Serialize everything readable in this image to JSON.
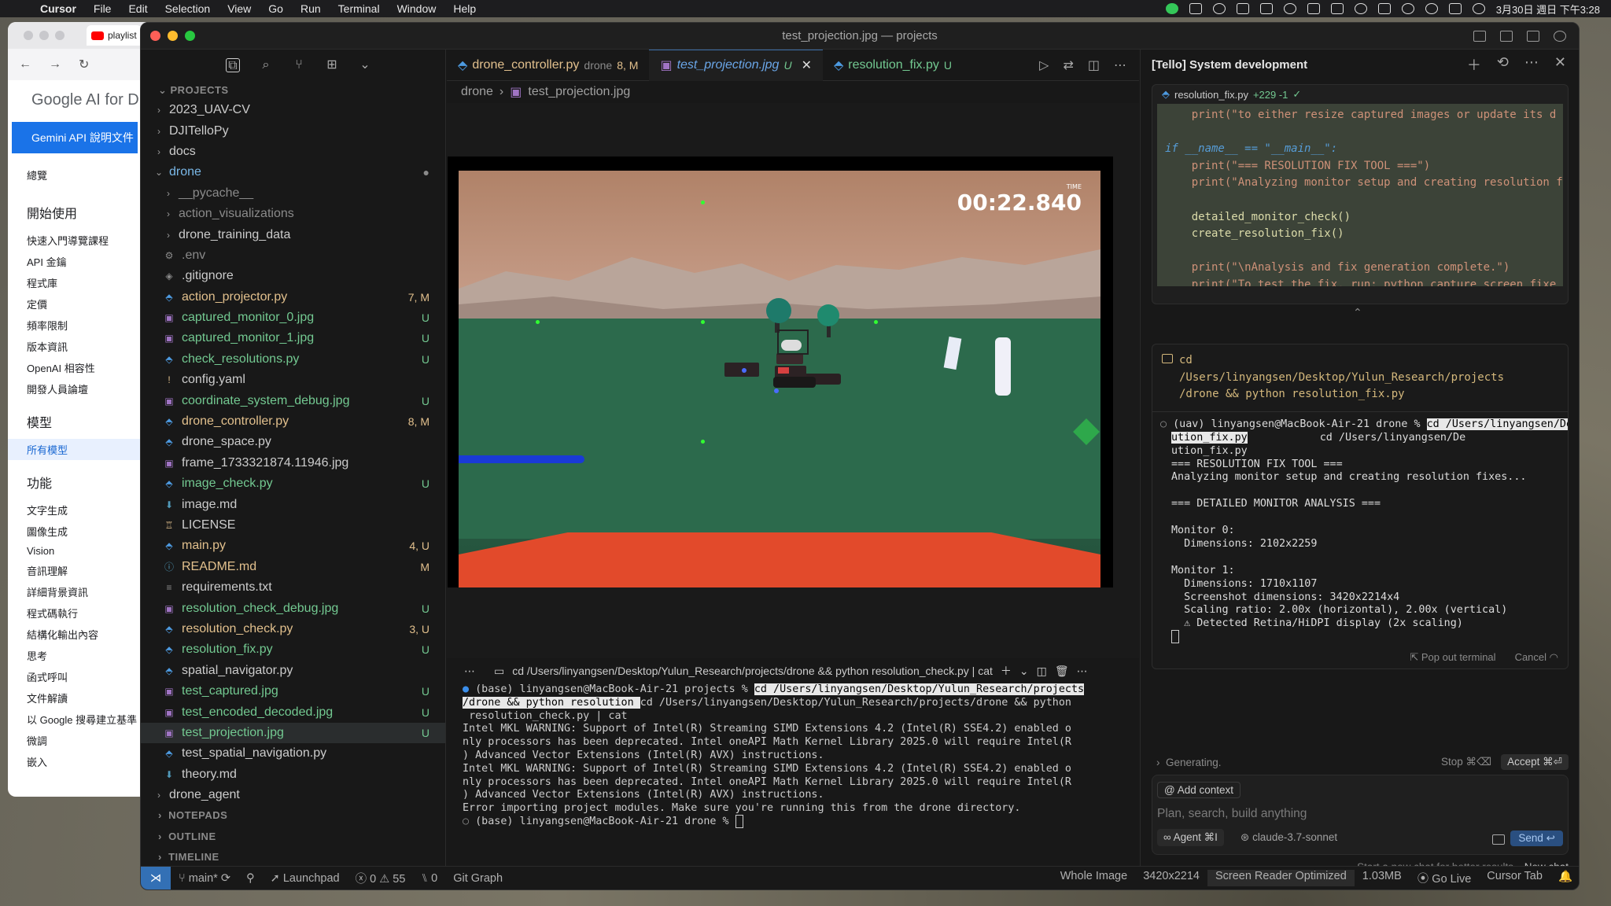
{
  "menubar": {
    "app": "Cursor",
    "items": [
      "File",
      "Edit",
      "Selection",
      "View",
      "Go",
      "Run",
      "Terminal",
      "Window",
      "Help"
    ],
    "datetime": "3月30日 週日 下午3:28"
  },
  "browser": {
    "tab_title": "playlist",
    "logo": "Google AI for D",
    "active_section": "Gemini API 說明文件",
    "sidebar": {
      "overview": "總覽",
      "get_started_h": "開始使用",
      "get_started": [
        "快速入門導覽課程",
        "API 金鑰",
        "程式庫",
        "定價",
        "頻率限制",
        "版本資訊",
        "OpenAI 相容性",
        "開發人員論壇"
      ],
      "models_h": "模型",
      "models": [
        "所有模型"
      ],
      "features_h": "功能",
      "features": [
        "文字生成",
        "圖像生成",
        "Vision",
        "音訊理解",
        "詳細背景資訊",
        "程式碼執行",
        "結構化輸出內容",
        "思考",
        "函式呼叫",
        "文件解讀",
        "以 Google 搜尋建立基準",
        "微調",
        "嵌入"
      ]
    }
  },
  "window": {
    "title": "test_projection.jpg — projects"
  },
  "explorer": {
    "projects_header": "PROJECTS",
    "rows": [
      {
        "name": "2023_UAV-CV",
        "kind": "folder",
        "depth": 0,
        "status": "",
        "color": "normal"
      },
      {
        "name": "DJITelloPy",
        "kind": "folder",
        "depth": 0,
        "status": "",
        "color": "normal"
      },
      {
        "name": "docs",
        "kind": "folder",
        "depth": 0,
        "status": "",
        "color": "normal"
      },
      {
        "name": "drone",
        "kind": "folder-open",
        "depth": 0,
        "status": "●",
        "color": "mod"
      },
      {
        "name": "__pycache__",
        "kind": "folder",
        "depth": 1,
        "status": "",
        "color": "dim"
      },
      {
        "name": "action_visualizations",
        "kind": "folder",
        "depth": 1,
        "status": "",
        "color": "dim"
      },
      {
        "name": "drone_training_data",
        "kind": "folder",
        "depth": 1,
        "status": "",
        "color": "normal"
      },
      {
        "name": ".env",
        "kind": "gear",
        "depth": 1,
        "status": "",
        "color": "dim"
      },
      {
        "name": ".gitignore",
        "kind": "git",
        "depth": 1,
        "status": "",
        "color": "normal"
      },
      {
        "name": "action_projector.py",
        "kind": "py",
        "depth": 1,
        "status": "7, M",
        "color": "mod"
      },
      {
        "name": "captured_monitor_0.jpg",
        "kind": "img",
        "depth": 1,
        "status": "U",
        "color": "untr"
      },
      {
        "name": "captured_monitor_1.jpg",
        "kind": "img",
        "depth": 1,
        "status": "U",
        "color": "untr"
      },
      {
        "name": "check_resolutions.py",
        "kind": "py",
        "depth": 1,
        "status": "U",
        "color": "untr"
      },
      {
        "name": "config.yaml",
        "kind": "yaml",
        "depth": 1,
        "status": "",
        "color": "normal"
      },
      {
        "name": "coordinate_system_debug.jpg",
        "kind": "img",
        "depth": 1,
        "status": "U",
        "color": "untr"
      },
      {
        "name": "drone_controller.py",
        "kind": "py",
        "depth": 1,
        "status": "8, M",
        "color": "mod"
      },
      {
        "name": "drone_space.py",
        "kind": "py",
        "depth": 1,
        "status": "",
        "color": "normal"
      },
      {
        "name": "frame_1733321874.11946.jpg",
        "kind": "img",
        "depth": 1,
        "status": "",
        "color": "normal"
      },
      {
        "name": "image_check.py",
        "kind": "py",
        "depth": 1,
        "status": "U",
        "color": "untr"
      },
      {
        "name": "image.md",
        "kind": "md",
        "depth": 1,
        "status": "",
        "color": "normal"
      },
      {
        "name": "LICENSE",
        "kind": "license",
        "depth": 1,
        "status": "",
        "color": "normal"
      },
      {
        "name": "main.py",
        "kind": "py",
        "depth": 1,
        "status": "4, U",
        "color": "mod"
      },
      {
        "name": "README.md",
        "kind": "info",
        "depth": 1,
        "status": "M",
        "color": "mod"
      },
      {
        "name": "requirements.txt",
        "kind": "txt",
        "depth": 1,
        "status": "",
        "color": "normal"
      },
      {
        "name": "resolution_check_debug.jpg",
        "kind": "img",
        "depth": 1,
        "status": "U",
        "color": "untr"
      },
      {
        "name": "resolution_check.py",
        "kind": "py",
        "depth": 1,
        "status": "3, U",
        "color": "mod"
      },
      {
        "name": "resolution_fix.py",
        "kind": "py",
        "depth": 1,
        "status": "U",
        "color": "untr"
      },
      {
        "name": "spatial_navigator.py",
        "kind": "py",
        "depth": 1,
        "status": "",
        "color": "normal"
      },
      {
        "name": "test_captured.jpg",
        "kind": "img",
        "depth": 1,
        "status": "U",
        "color": "untr"
      },
      {
        "name": "test_encoded_decoded.jpg",
        "kind": "img",
        "depth": 1,
        "status": "U",
        "color": "untr"
      },
      {
        "name": "test_projection.jpg",
        "kind": "img",
        "depth": 1,
        "status": "U",
        "color": "untr",
        "selected": true
      },
      {
        "name": "test_spatial_navigation.py",
        "kind": "py",
        "depth": 1,
        "status": "",
        "color": "normal"
      },
      {
        "name": "theory.md",
        "kind": "md",
        "depth": 1,
        "status": "",
        "color": "normal"
      },
      {
        "name": "drone_agent",
        "kind": "folder",
        "depth": 0,
        "status": "",
        "color": "normal"
      }
    ],
    "bottom_sections": [
      "NOTEPADS",
      "OUTLINE",
      "TIMELINE"
    ]
  },
  "tabs": [
    {
      "label": "drone_controller.py",
      "extra": "drone",
      "badge": "8, M",
      "active": false
    },
    {
      "label": "test_projection.jpg",
      "extra": "",
      "badge": "U",
      "active": true
    },
    {
      "label": "resolution_fix.py",
      "extra": "",
      "badge": "U",
      "active": false
    }
  ],
  "breadcrumb": {
    "folder": "drone",
    "file": "test_projection.jpg"
  },
  "sim": {
    "timer": "00:22.840",
    "timer_label": "TIME"
  },
  "terminal": {
    "tab_title": "cd /Users/linyangsen/Desktop/Yulun_Research/projects/drone && python resolution_check.py | cat",
    "lines": [
      "(base) linyangsen@MacBook-Air-21 projects % ",
      "cd /Users/linyangsen/Desktop/Yulun_Research/projects/drone && python resolution_check.py | cat",
      "/drone && python resolution ",
      "cd /Users/linyangsen/Desktop/Yulun_Research/projects/drone && python",
      " resolution_check.py | cat",
      "Intel MKL WARNING: Support of Intel(R) Streaming SIMD Extensions 4.2 (Intel(R) SSE4.2) enabled o",
      "nly processors has been deprecated. Intel oneAPI Math Kernel Library 2025.0 will require Intel(R",
      ") Advanced Vector Extensions (Intel(R) AVX) instructions.",
      "Intel MKL WARNING: Support of Intel(R) Streaming SIMD Extensions 4.2 (Intel(R) SSE4.2) enabled o",
      "nly processors has been deprecated. Intel oneAPI Math Kernel Library 2025.0 will require Intel(R",
      ") Advanced Vector Extensions (Intel(R) AVX) instructions.",
      "Error importing project modules. Make sure you're running this from the drone directory.",
      "(base) linyangsen@MacBook-Air-21 drone % "
    ]
  },
  "status": {
    "branch": "main*",
    "launchpad": "Launchpad",
    "errors": "0",
    "warnings": "55",
    "ports": "0",
    "git_graph": "Git Graph",
    "right": [
      "Whole Image",
      "3420x2214",
      "Screen Reader Optimized",
      "1.03MB",
      "Go Live",
      "Cursor Tab"
    ]
  },
  "chat": {
    "title": "[Tello] System development",
    "code_file": "resolution_fix.py",
    "code_diff": "+229 -1",
    "code_lines": [
      "    print(\"to either resize captured images or update its d",
      "",
      "if __name__ == \"__main__\":",
      "    print(\"=== RESOLUTION FIX TOOL ===\")",
      "    print(\"Analyzing monitor setup and creating resolution f",
      "",
      "    detailed_monitor_check()",
      "    create_resolution_fix()",
      "",
      "    print(\"\\nAnalysis and fix generation complete.\")",
      "    print(\"To test the fix, run: python capture_screen_fixe"
    ],
    "cmd": "cd\n/Users/linyangsen/Desktop/Yulun_Research/projects\n/drone && python resolution_fix.py",
    "term_lines": [
      "(uav) linyangsen@MacBook-Air-21 drone % ",
      "cd /Users/linyangsen/De",
      "ution_fix.py",
      "cd /Users/linyangsen/De",
      "ution_fix.py",
      "=== RESOLUTION FIX TOOL ===",
      "Analyzing monitor setup and creating resolution fixes...",
      "",
      "=== DETAILED MONITOR ANALYSIS ===",
      "",
      "Monitor 0:",
      "  Dimensions: 2102x2259",
      "",
      "Monitor 1:",
      "  Dimensions: 1710x1107",
      "  Screenshot dimensions: 3420x2214x4",
      "  Scaling ratio: 2.00x (horizontal), 2.00x (vertical)",
      "  ⚠ Detected Retina/HiDPI display (2x scaling)"
    ],
    "popout": "Pop out terminal",
    "cancel": "Cancel",
    "generating": "Generating.",
    "stop": "Stop ⌘⌫",
    "accept": "Accept ⌘⏎",
    "add_context": "Add context",
    "placeholder": "Plan, search, build anything",
    "agent": "∞ Agent ⌘I",
    "model": "claude-3.7-sonnet",
    "send": "Send ↩",
    "footer_note": "Start a new chat for better results.",
    "new_chat": "New chat"
  }
}
